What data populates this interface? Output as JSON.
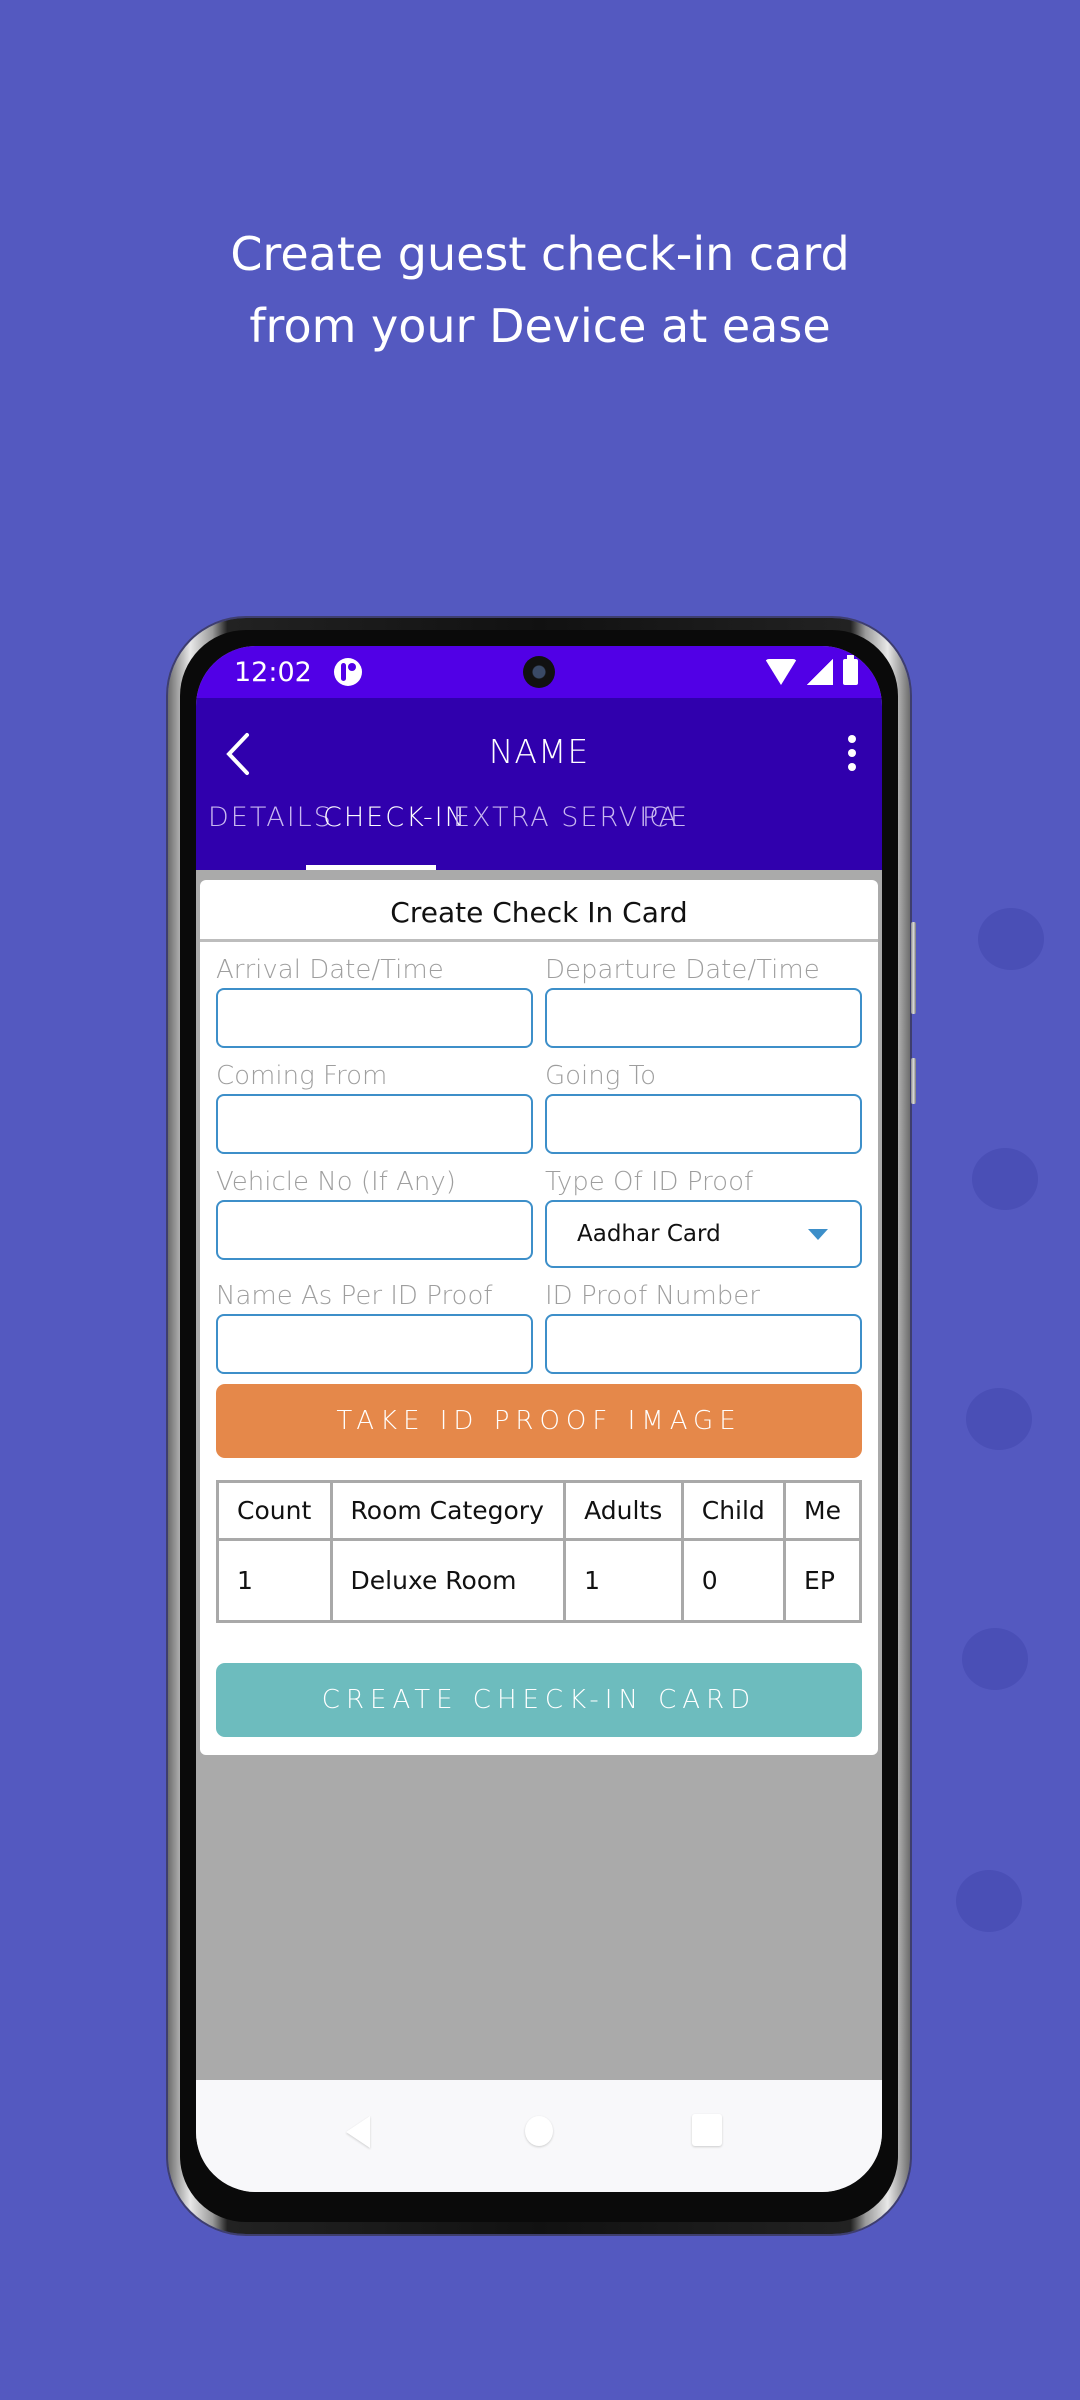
{
  "headline": {
    "line1": "Create guest check-in card",
    "line2": "from your Device at ease"
  },
  "status_bar": {
    "time": "12:02",
    "icons": [
      "app-notification-icon",
      "wifi-icon",
      "signal-icon",
      "battery-icon"
    ]
  },
  "app_bar": {
    "title": "NAME",
    "back_icon": "chevron-left-icon",
    "menu_icon": "more-vert-icon"
  },
  "tabs": [
    {
      "label": "DETAILS",
      "active": false
    },
    {
      "label": "CHECK-IN",
      "active": true
    },
    {
      "label": "EXTRA SERVICE",
      "active": false
    },
    {
      "label": "PA",
      "active": false
    }
  ],
  "form": {
    "title": "Create Check In Card",
    "fields": {
      "arrival": {
        "label": "Arrival Date/Time",
        "value": ""
      },
      "departure": {
        "label": "Departure Date/Time",
        "value": ""
      },
      "coming_from": {
        "label": "Coming From",
        "value": ""
      },
      "going_to": {
        "label": "Going To",
        "value": ""
      },
      "vehicle_no": {
        "label": "Vehicle No (If Any)",
        "value": ""
      },
      "id_type": {
        "label": "Type Of ID Proof",
        "value": "Aadhar Card"
      },
      "name_as_per_id": {
        "label": "Name As Per ID Proof",
        "value": ""
      },
      "id_number": {
        "label": "ID Proof Number",
        "value": ""
      }
    },
    "take_image_label": "TAKE ID PROOF IMAGE",
    "create_label": "CREATE CHECK-IN CARD"
  },
  "room_table": {
    "headers": [
      "Count",
      "Room Category",
      "Adults",
      "Child",
      "Me"
    ],
    "rows": [
      [
        "1",
        "Deluxe Room",
        "1",
        "0",
        "EP"
      ]
    ]
  },
  "colors": {
    "background": "#5459c0",
    "status_bar": "#5100e6",
    "app_bar": "#3000ad",
    "input_border": "#3d8fc9",
    "take_image_button": "#e5884a",
    "create_button": "#6dbcbe"
  }
}
